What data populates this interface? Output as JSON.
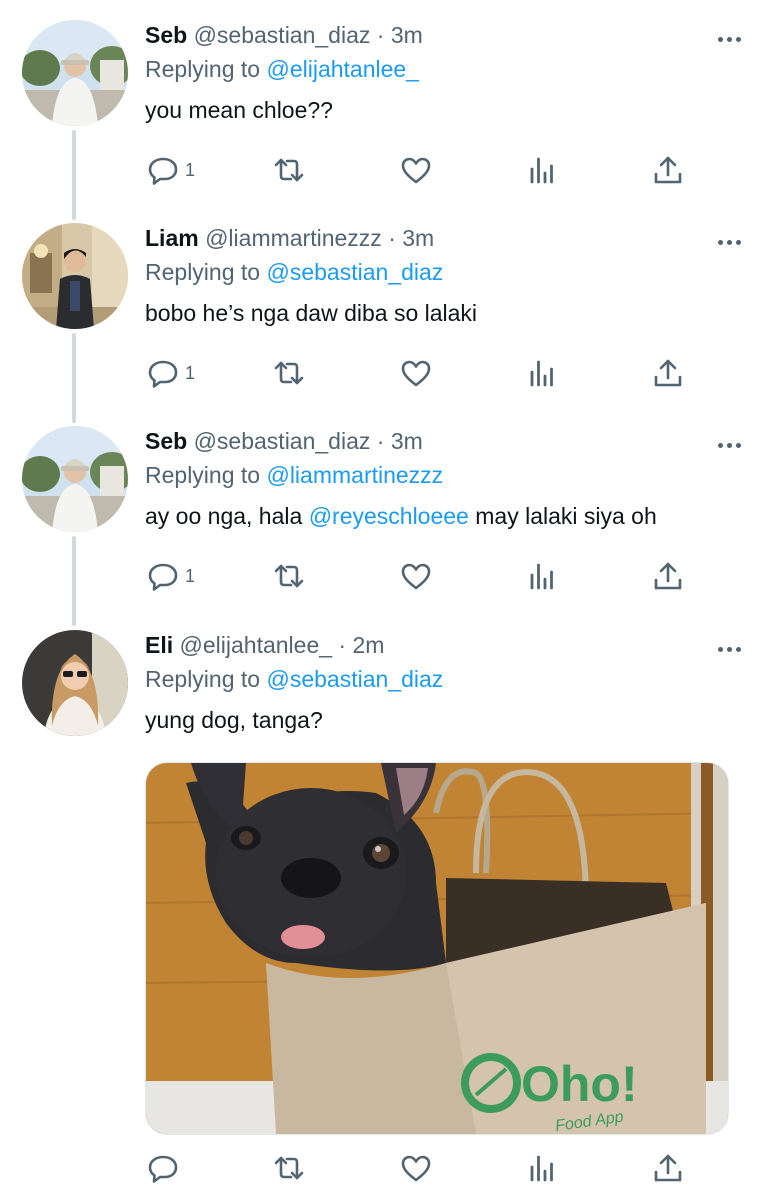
{
  "tweets": [
    {
      "name": "Seb",
      "handle": "@sebastian_diaz",
      "time": "3m",
      "replying_prefix": "Replying to",
      "replying_to": "@elijahtanlee_",
      "text": "you mean chloe??",
      "reply_count": "1"
    },
    {
      "name": "Liam",
      "handle": "@liammartinezzz",
      "time": "3m",
      "replying_prefix": "Replying to",
      "replying_to": "@sebastian_diaz",
      "text": "bobo he’s nga daw diba so lalaki",
      "reply_count": "1"
    },
    {
      "name": "Seb",
      "handle": "@sebastian_diaz",
      "time": "3m",
      "replying_prefix": "Replying to",
      "replying_to": "@liammartinezzz",
      "text_before": "ay oo nga, hala ",
      "text_mention": "@reyeschloeee",
      "text_after": " may lalaki siya oh",
      "reply_count": "1"
    },
    {
      "name": "Eli",
      "handle": "@elijahtanlee_",
      "time": "2m",
      "replying_prefix": "Replying to",
      "replying_to": "@sebastian_diaz",
      "text": "yung dog, tanga?",
      "reply_count": "",
      "media": {
        "bag_logo": "Oho!",
        "bag_tagline": "Food App"
      }
    }
  ],
  "separator": "·",
  "icons": [
    "reply-icon",
    "retweet-icon",
    "like-icon",
    "analytics-icon",
    "share-icon",
    "more-icon"
  ],
  "colors": {
    "link": "#1d9bf0",
    "muted": "#536471",
    "text": "#0f1419",
    "thread_line": "#cfd9de"
  }
}
